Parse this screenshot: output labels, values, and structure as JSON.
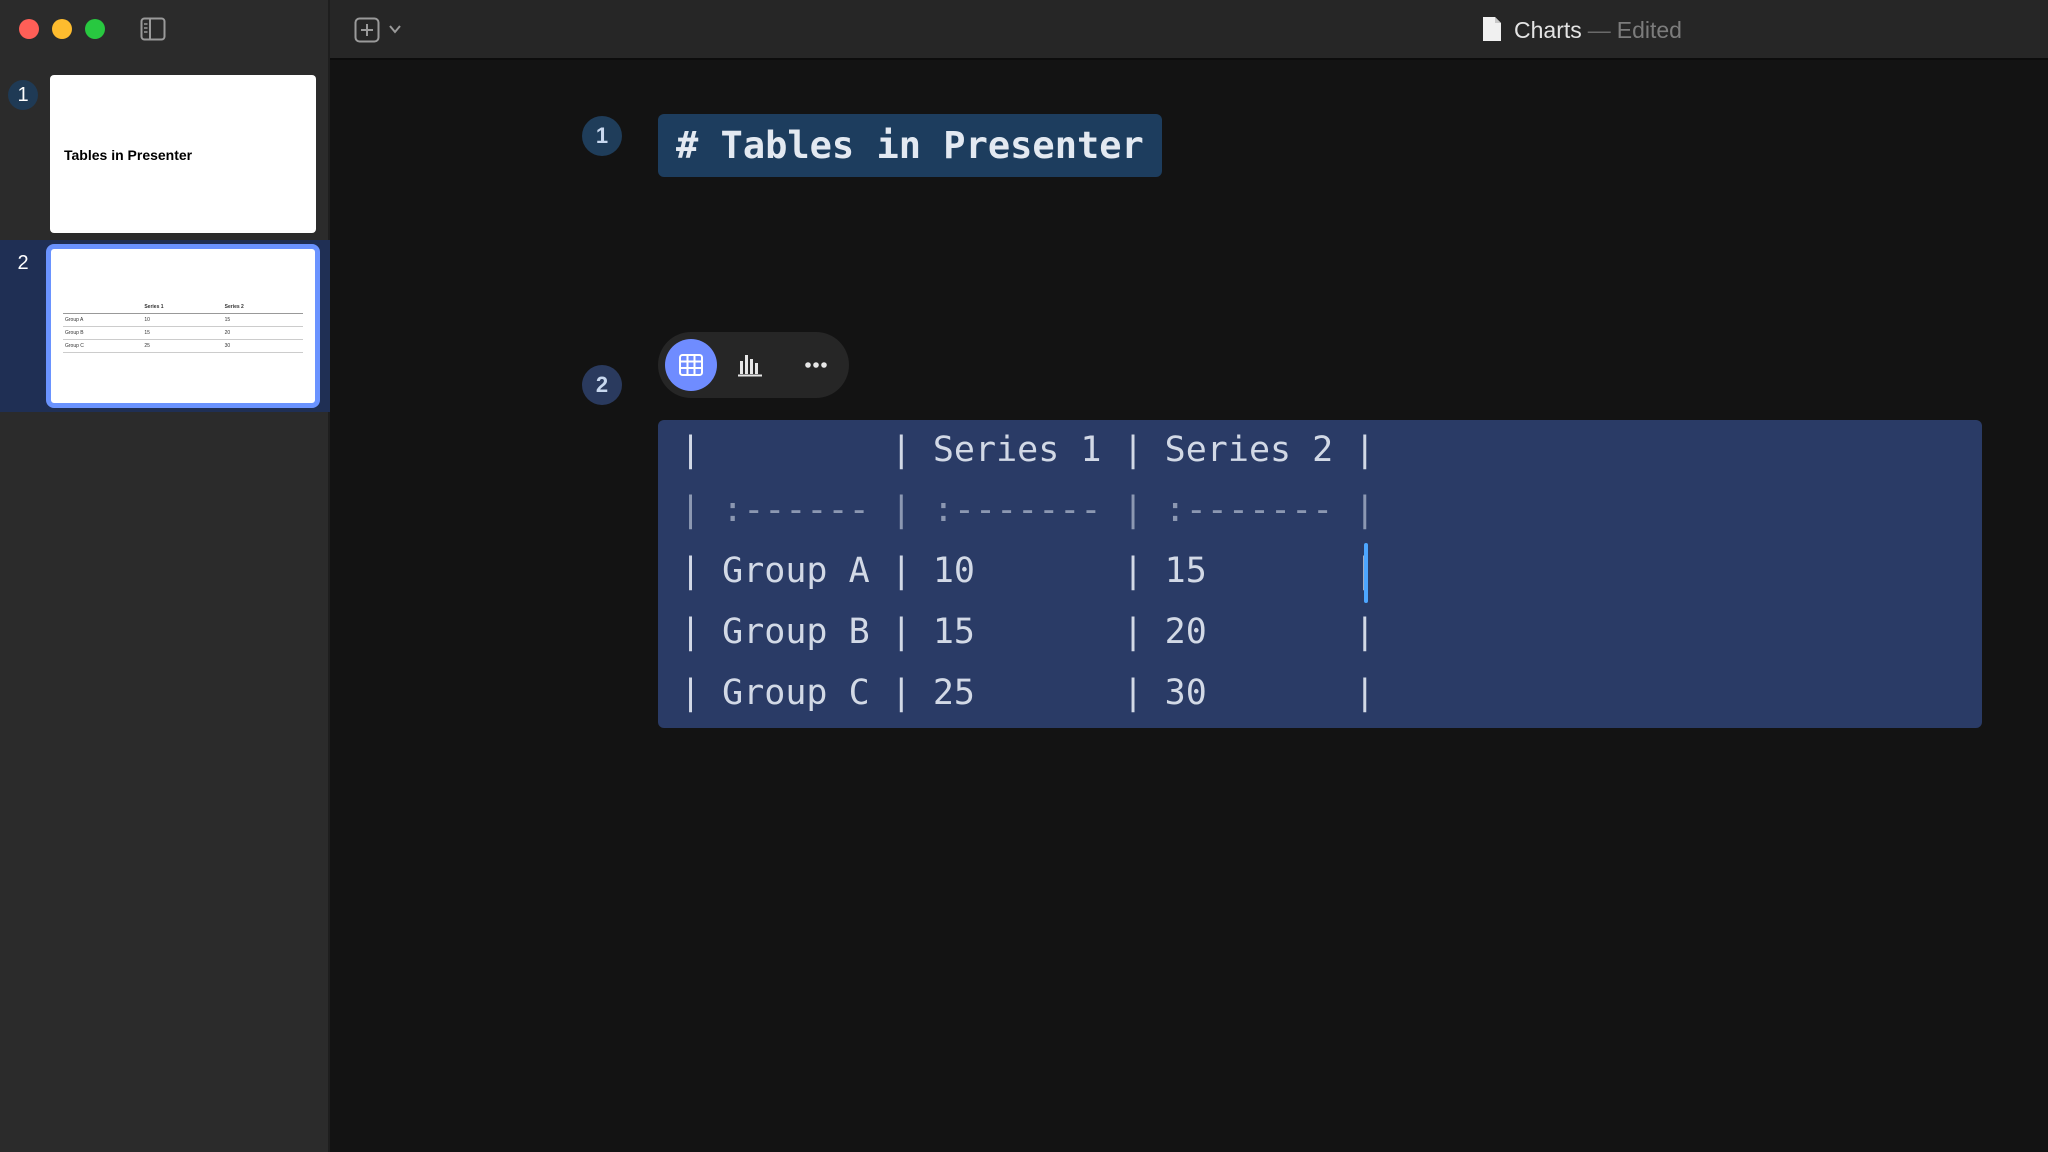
{
  "window": {
    "title": "Charts",
    "status": "Edited"
  },
  "sidebar": {
    "slides": [
      {
        "number": "1",
        "title": "Tables in Presenter"
      },
      {
        "number": "2",
        "table": {
          "headers": [
            "",
            "Series 1",
            "Series 2"
          ],
          "rows": [
            [
              "Group A",
              "10",
              "15"
            ],
            [
              "Group B",
              "15",
              "20"
            ],
            [
              "Group C",
              "25",
              "30"
            ]
          ]
        }
      }
    ]
  },
  "editor": {
    "slide1": {
      "badge": "1",
      "heading": "# Tables in Presenter"
    },
    "slide2": {
      "badge": "2",
      "lines": [
        "|         | Series 1 | Series 2 |",
        "| :------ | :------- | :------- |",
        "| Group A | 10       | 15       |",
        "| Group B | 15       | 20       |",
        "| Group C | 25       | 30       |"
      ]
    }
  },
  "icons": {
    "sidebar_toggle": "sidebar-icon",
    "add_slide": "plus-square-icon",
    "table": "table-icon",
    "chart": "bar-chart-icon",
    "more": "ellipsis-icon"
  },
  "colors": {
    "accent": "#6f8cff",
    "table_bg": "#2a3b66",
    "heading_bg": "#1d3d5e",
    "caret": "#4da6ff"
  }
}
